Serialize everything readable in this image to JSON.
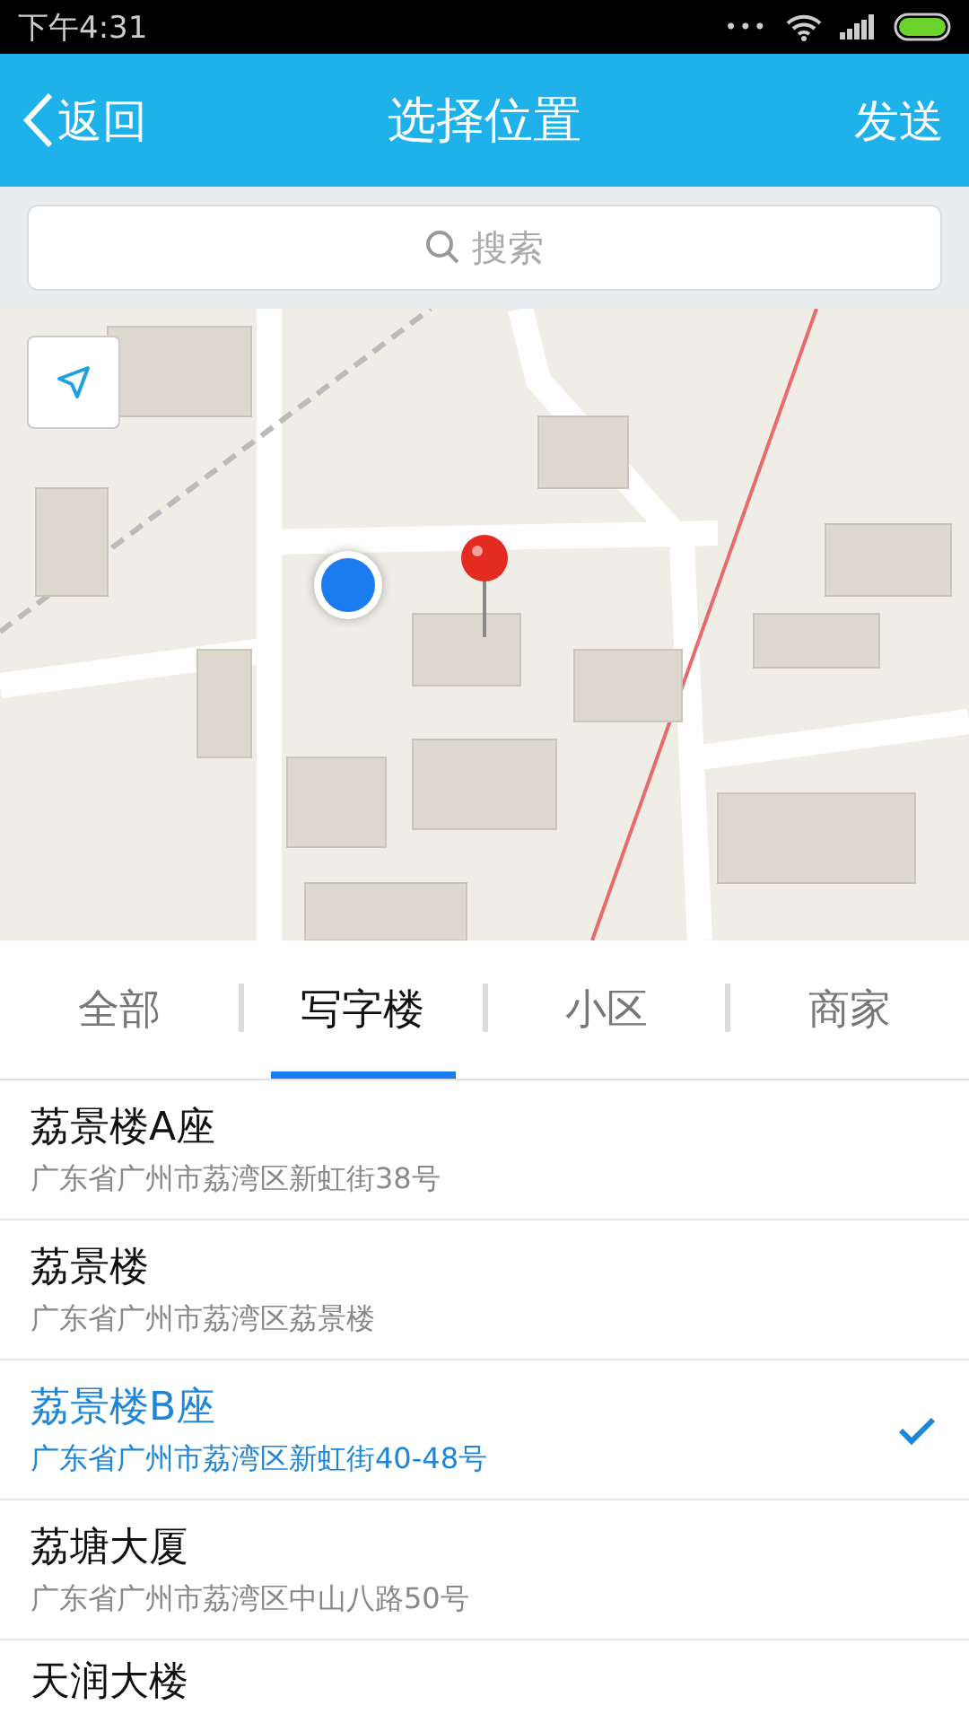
{
  "status_bar": {
    "time": "下午4:31",
    "dots": "•••"
  },
  "nav": {
    "back": "返回",
    "title": "选择位置",
    "action": "发送"
  },
  "search": {
    "placeholder": "搜索"
  },
  "tabs": [
    {
      "label": "全部",
      "selected": false
    },
    {
      "label": "写字楼",
      "selected": true
    },
    {
      "label": "小区",
      "selected": false
    },
    {
      "label": "商家",
      "selected": false
    }
  ],
  "places": [
    {
      "name": "荔景楼A座",
      "address": "广东省广州市荔湾区新虹街38号",
      "selected": false
    },
    {
      "name": "荔景楼",
      "address": "广东省广州市荔湾区荔景楼",
      "selected": false
    },
    {
      "name": "荔景楼B座",
      "address": "广东省广州市荔湾区新虹街40-48号",
      "selected": true
    },
    {
      "name": "荔塘大厦",
      "address": "广东省广州市荔湾区中山八路50号",
      "selected": false
    },
    {
      "name": "天润大楼",
      "selected": false
    }
  ]
}
